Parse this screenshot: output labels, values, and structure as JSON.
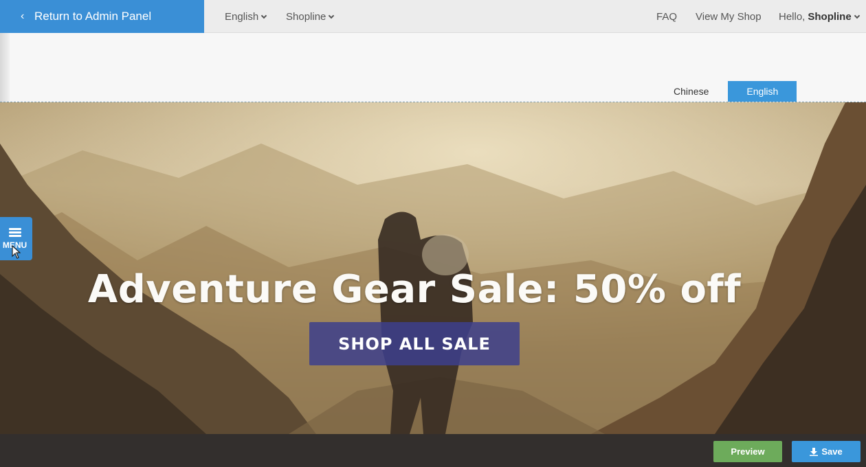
{
  "topbar": {
    "back_label": "Return to Admin Panel",
    "language": "English",
    "shop": "Shopline",
    "faq": "FAQ",
    "view_shop": "View My Shop",
    "greeting": "Hello,",
    "username": "Shopline"
  },
  "lang_tabs": [
    {
      "label": "Chinese",
      "active": false
    },
    {
      "label": "English",
      "active": true
    }
  ],
  "hero": {
    "title": "Adventure Gear Sale: 50% off",
    "cta": "SHOP ALL SALE"
  },
  "menu": {
    "label": "MENU"
  },
  "bottombar": {
    "preview": "Preview",
    "save": "Save"
  },
  "colors": {
    "primary": "#3a8fd6",
    "preview_green": "#6dab5b",
    "cta_indigo": "#3d3f8c",
    "bottom_bg": "#332f2d"
  }
}
